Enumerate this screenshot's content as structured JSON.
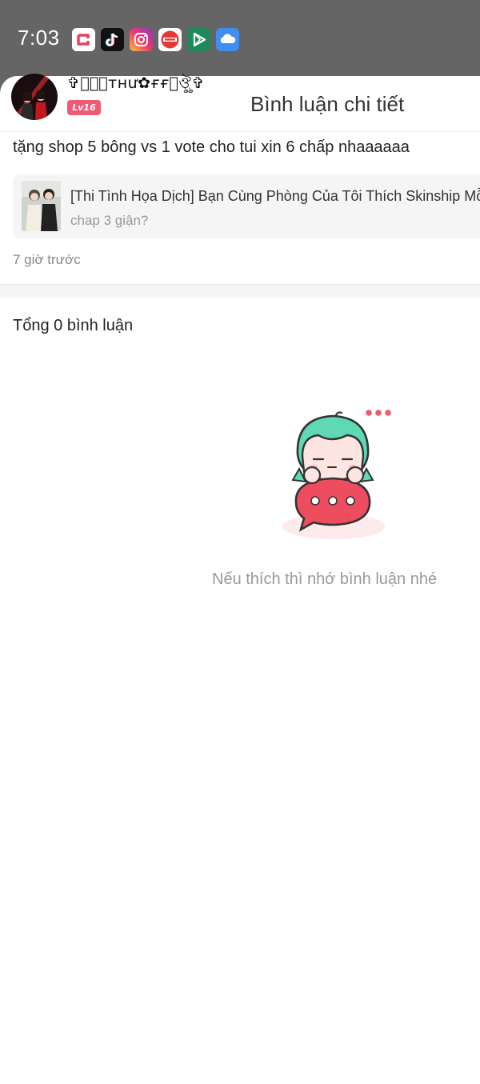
{
  "status_bar": {
    "time": "7:03",
    "icons": [
      "capcut-icon",
      "tiktok-icon",
      "instagram-icon",
      "manga-toon-icon",
      "play-store-icon",
      "cloud-icon"
    ]
  },
  "header": {
    "title": "Bình luận chi tiết"
  },
  "comment": {
    "user_name": "✞ঔৣ⃝ᴛʜư✿ғғ⃝ঔৣ✞",
    "level": "Lv16",
    "text": "tặng shop 5 bông vs 1 vote cho tui xin 6 chấp nhaaaaaa",
    "story": {
      "title": "[Thi Tình Họa Dịch] Bạn Cùng Phòng Của Tôi Thích Skinship Mỗi",
      "subtitle": "chap 3 giận?"
    },
    "time_ago": "7 giờ trước"
  },
  "comments_section": {
    "total_label": "Tổng 0 bình luận",
    "empty_message": "Nếu thích thì nhớ bình luận nhé"
  },
  "colors": {
    "status_bar_bg": "#656565",
    "badge": "#ee5a73",
    "mascot_hair": "#5fd8b5",
    "mascot_bubble": "#ee4d5f"
  }
}
